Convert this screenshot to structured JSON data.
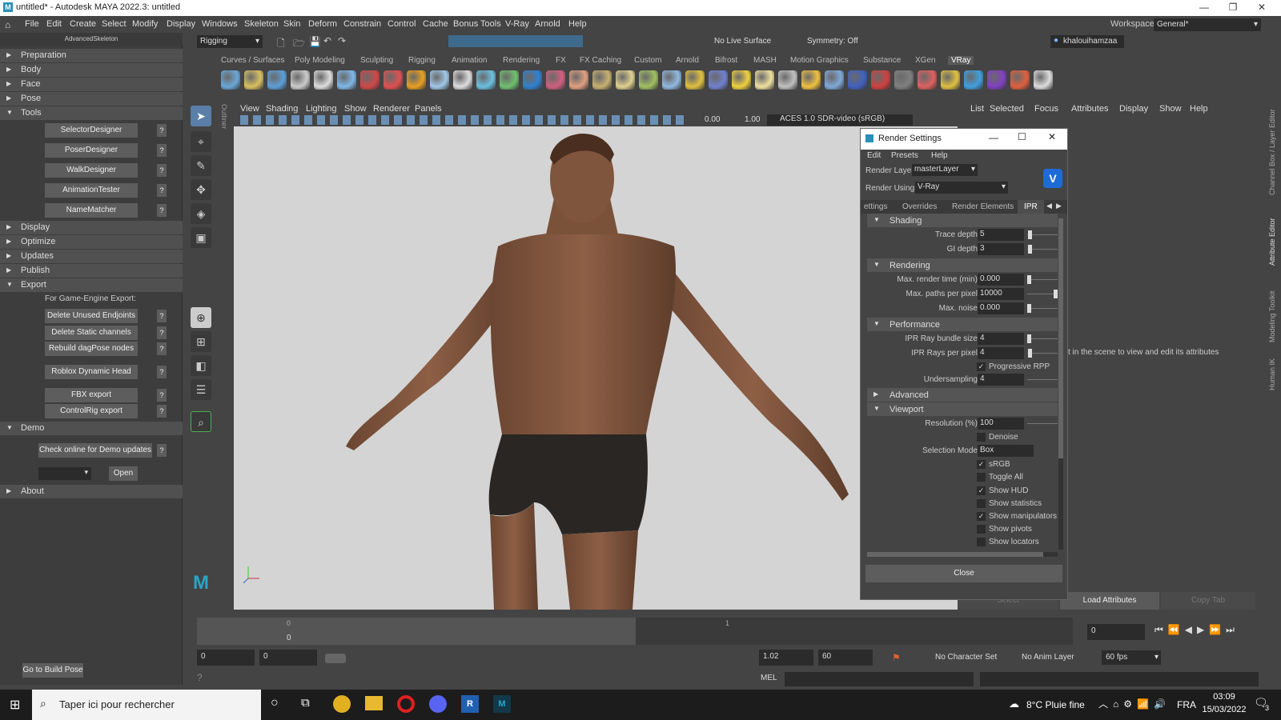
{
  "window": {
    "title": "untitled* - Autodesk MAYA 2022.3: untitled"
  },
  "menu": [
    "File",
    "Edit",
    "Create",
    "Select",
    "Modify",
    "Display",
    "Windows",
    "Skeleton",
    "Skin",
    "Deform",
    "Constrain",
    "Control",
    "Cache",
    "Bonus Tools",
    "V-Ray",
    "Arnold",
    "Help"
  ],
  "workspace": {
    "label": "Workspace:",
    "value": "General*"
  },
  "left_panel": {
    "title": "AdvancedSkeleton",
    "sections": {
      "preparation": "Preparation",
      "body": "Body",
      "face": "Face",
      "pose": "Pose",
      "tools": "Tools",
      "display": "Display",
      "optimize": "Optimize",
      "updates": "Updates",
      "publish": "Publish",
      "export": "Export",
      "demo": "Demo",
      "about": "About"
    },
    "tools_buttons": [
      "SelectorDesigner",
      "PoserDesigner",
      "WalkDesigner",
      "AnimationTester",
      "NameMatcher"
    ],
    "export_label": "For Game-Engine Export:",
    "export_buttons": [
      "Delete Unused Endjoints",
      "Delete Static channels",
      "Rebuild dagPose nodes",
      "Roblox Dynamic Head",
      "FBX export",
      "ControlRig export"
    ],
    "demo_button": "Check online for Demo updates",
    "open_button": "Open",
    "go_build_pose": "Go to Build Pose",
    "help_glyph": "?"
  },
  "shelf": {
    "mode": "Rigging",
    "live_surface": "No Live Surface",
    "symmetry": "Symmetry: Off",
    "user": "khalouihamzaa",
    "tabs": [
      "Curves / Surfaces",
      "Poly Modeling",
      "Sculpting",
      "Rigging",
      "Animation",
      "Rendering",
      "FX",
      "FX Caching",
      "Custom",
      "Arnold",
      "Bifrost",
      "MASH",
      "Motion Graphics",
      "Substance",
      "XGen",
      "VRay"
    ],
    "active_tab": "VRay",
    "icon_colors": [
      "#6aa7d8",
      "#d8c060",
      "#5d9fd8",
      "#cccccc",
      "#dddddd",
      "#7fb6e8",
      "#d04848",
      "#e05050",
      "#e8a020",
      "#a0c8e8",
      "#dddddd",
      "#6cc0e0",
      "#70c070",
      "#3080d0",
      "#d06080",
      "#e0a080",
      "#c8b070",
      "#e0d090",
      "#a0c060",
      "#90b8e0",
      "#e0c040",
      "#7080d0",
      "#f0d040",
      "#f0e0a0",
      "#c0c0c0",
      "#f0c040",
      "#80a8d8",
      "#4060c0",
      "#d04040",
      "#808080",
      "#e06060",
      "#e0c040",
      "#40a0e0",
      "#8040c0",
      "#e06040",
      "#dddddd"
    ]
  },
  "viewport": {
    "menus": [
      "View",
      "Shading",
      "Lighting",
      "Show",
      "Renderer",
      "Panels"
    ],
    "exposure": "0.00",
    "gamma": "1.00",
    "colorspace": "ACES 1.0 SDR-video (sRGB)",
    "outliner": "Outliner"
  },
  "render_settings": {
    "title": "Render Settings",
    "menus": [
      "Edit",
      "Presets",
      "Help"
    ],
    "render_layer_label": "Render Layer",
    "render_layer_value": "masterLayer",
    "render_using_label": "Render Using",
    "render_using_value": "V-Ray",
    "tabs": [
      "ettings",
      "Overrides",
      "Render Elements",
      "IPR"
    ],
    "active_tab": "IPR",
    "shading": {
      "title": "Shading",
      "trace_depth_label": "Trace depth",
      "trace_depth": "5",
      "gi_depth_label": "GI depth",
      "gi_depth": "3"
    },
    "rendering": {
      "title": "Rendering",
      "max_time_label": "Max. render time (min)",
      "max_time": "0.000",
      "max_paths_label": "Max. paths per pixel",
      "max_paths": "10000",
      "max_noise_label": "Max. noise",
      "max_noise": "0.000"
    },
    "performance": {
      "title": "Performance",
      "bundle_label": "IPR Ray bundle size",
      "bundle": "4",
      "rays_label": "IPR Rays per pixel",
      "rays": "4",
      "progressive": "Progressive RPP",
      "under_label": "Undersampling",
      "under": "4"
    },
    "advanced": "Advanced",
    "viewport_sec": {
      "title": "Viewport",
      "resolution_label": "Resolution (%)",
      "resolution": "100",
      "denoise": "Denoise",
      "selection_label": "Selection Mode",
      "selection": "Box",
      "srgb": "sRGB",
      "toggle_all": "Toggle All",
      "show_hud": "Show HUD",
      "show_stats": "Show statistics",
      "show_manip": "Show manipulators",
      "show_pivots": "Show pivots",
      "show_locators": "Show locators"
    },
    "close": "Close"
  },
  "attribute_editor": {
    "menus": [
      "List",
      "Selected",
      "Focus",
      "Attributes",
      "Display",
      "Show",
      "Help"
    ],
    "hint": "t in the scene to view and edit its attributes",
    "select": "Select",
    "load": "Load Attributes",
    "copy": "Copy Tab"
  },
  "side_tabs": [
    "Channel Box / Layer Editor",
    "Attribute Editor",
    "Modeling Toolkit",
    "Human IK"
  ],
  "timeline": {
    "start_tick": "0",
    "mid_tick": "1",
    "frame_label": "0",
    "current_frame": "0"
  },
  "range": {
    "start": "0",
    "start2": "0",
    "end": "1.02",
    "end2": "60",
    "char_set": "No Character Set",
    "anim_layer": "No Anim Layer",
    "fps": "60 fps"
  },
  "mel": {
    "label": "MEL"
  },
  "taskbar": {
    "search": "Taper ici pour rechercher",
    "weather": "8°C Pluie fine",
    "lang": "FRA",
    "time": "03:09",
    "date": "15/03/2022",
    "notif": "3"
  }
}
